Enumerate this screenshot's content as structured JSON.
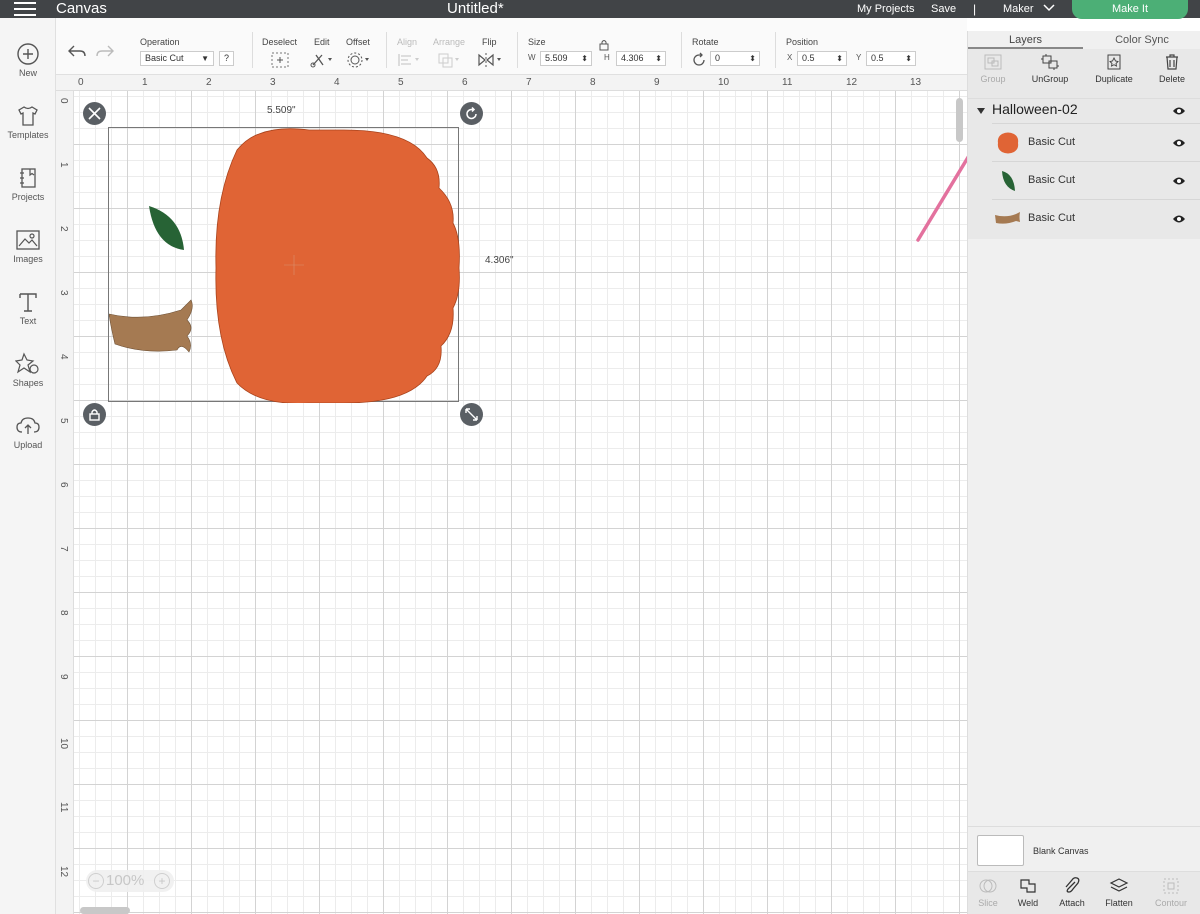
{
  "topbar": {
    "app_title": "Canvas",
    "doc_title": "Untitled*",
    "my_projects": "My Projects",
    "save": "Save",
    "separator": "|",
    "machine": "Maker",
    "make_it": "Make It",
    "make_it_color": "#4caf76"
  },
  "leftbar": {
    "items": [
      {
        "label": "New",
        "icon": "plus-circle-icon"
      },
      {
        "label": "Templates",
        "icon": "tshirt-icon"
      },
      {
        "label": "Projects",
        "icon": "notebook-icon"
      },
      {
        "label": "Images",
        "icon": "image-icon"
      },
      {
        "label": "Text",
        "icon": "text-t-icon"
      },
      {
        "label": "Shapes",
        "icon": "shapes-icon"
      },
      {
        "label": "Upload",
        "icon": "cloud-upload-icon"
      }
    ]
  },
  "toolbar": {
    "operation_label": "Operation",
    "operation_value": "Basic Cut",
    "help": "?",
    "deselect": "Deselect",
    "edit": "Edit",
    "offset": "Offset",
    "align": "Align",
    "arrange": "Arrange",
    "flip": "Flip",
    "size": "Size",
    "w_label": "W",
    "w_value": "5.509",
    "h_label": "H",
    "h_value": "4.306",
    "rotate": "Rotate",
    "rotate_value": "0",
    "position": "Position",
    "x_label": "X",
    "x_value": "0.5",
    "y_label": "Y",
    "y_value": "0.5"
  },
  "canvas": {
    "ruler_top": [
      "0",
      "1",
      "2",
      "3",
      "4",
      "5",
      "6",
      "7",
      "8",
      "9",
      "10",
      "11",
      "12",
      "13"
    ],
    "ruler_left": [
      "0",
      "1",
      "2",
      "3",
      "4",
      "5",
      "6",
      "7",
      "8",
      "9",
      "10",
      "11",
      "12"
    ],
    "width_label": "5.509\"",
    "height_label": "4.306\"",
    "zoom_value": "100%",
    "zoom_minus": "−",
    "zoom_plus": "+",
    "pumpkin_color": "#e06435",
    "leaf_color": "#276335",
    "stem_color": "#a57a52"
  },
  "rightpanel": {
    "tabs": [
      "Layers",
      "Color Sync"
    ],
    "actions": {
      "group": "Group",
      "ungroup": "UnGroup",
      "duplicate": "Duplicate",
      "delete": "Delete"
    },
    "group_name": "Halloween-02",
    "layers": [
      {
        "label": "Basic Cut",
        "shape": "pumpkin"
      },
      {
        "label": "Basic Cut",
        "shape": "leaf"
      },
      {
        "label": "Basic Cut",
        "shape": "stem"
      }
    ],
    "blank_canvas": "Blank Canvas",
    "bottom": {
      "slice": "Slice",
      "weld": "Weld",
      "attach": "Attach",
      "flatten": "Flatten",
      "contour": "Contour"
    },
    "arrow_color": "#e3719e"
  }
}
